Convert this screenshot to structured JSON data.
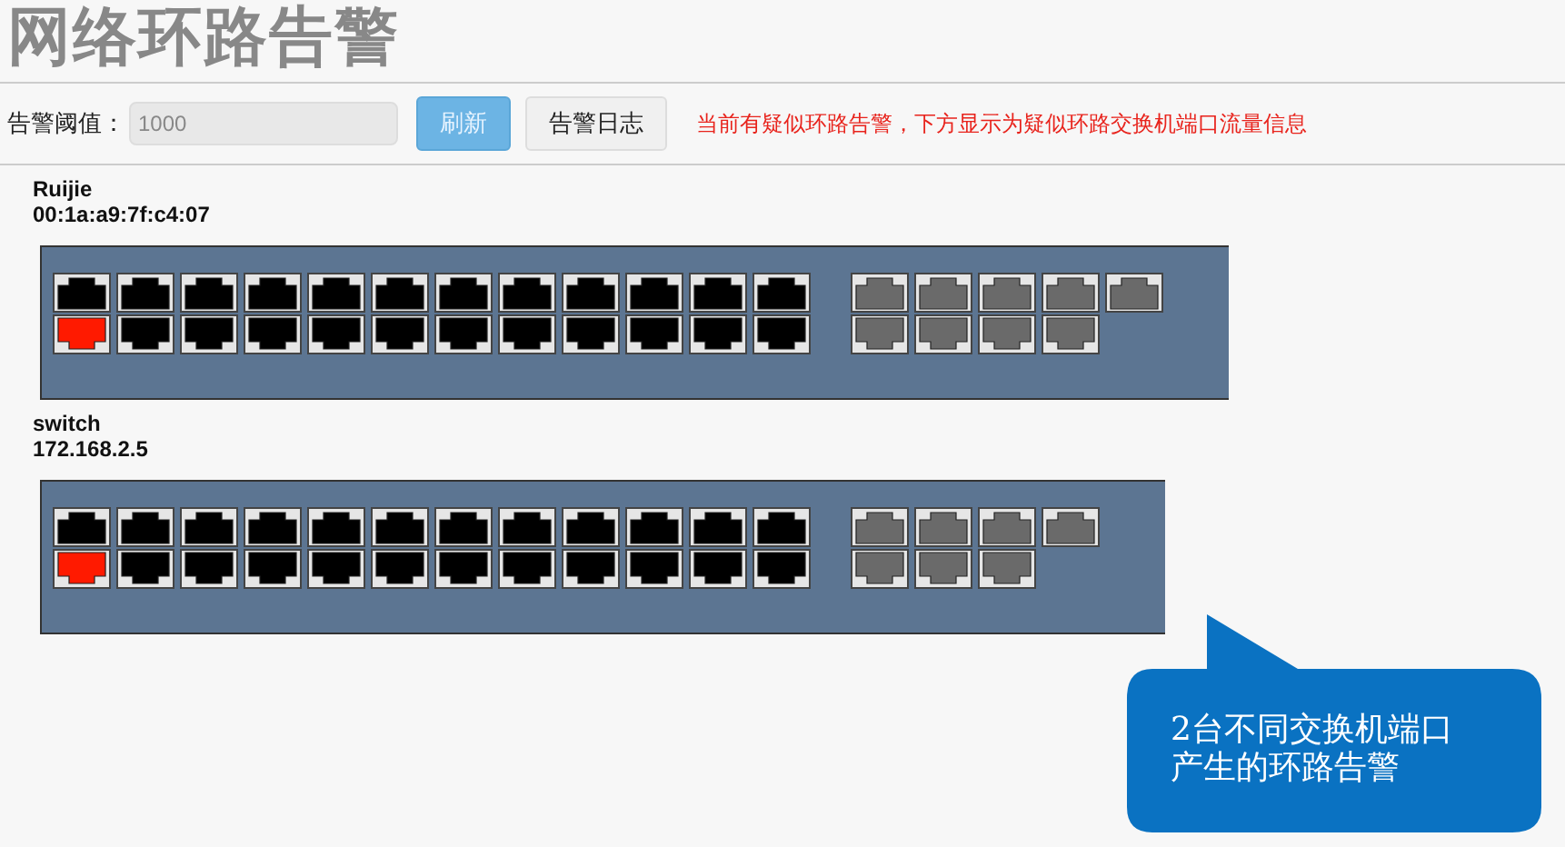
{
  "title": "网络环路告警",
  "toolbar": {
    "threshold_label": "告警阈值：",
    "threshold_value": "1000",
    "buttons": [
      {
        "label": "刷新",
        "kind": "primary"
      },
      {
        "label": "告警日志",
        "kind": "default"
      }
    ],
    "notice": "当前有疑似环路告警，下方显示为疑似环路交换机端口流量信息"
  },
  "switches": [
    {
      "name": "Ruijie",
      "address": "00:1a:a9:7f:c4:07",
      "port_columns": [
        {
          "kind": "copper",
          "ports": [
            {
              "alarm": false
            },
            {
              "alarm": true
            }
          ]
        },
        {
          "kind": "copper",
          "ports": [
            {
              "alarm": false
            },
            {
              "alarm": false
            }
          ]
        },
        {
          "kind": "copper",
          "ports": [
            {
              "alarm": false
            },
            {
              "alarm": false
            }
          ]
        },
        {
          "kind": "copper",
          "ports": [
            {
              "alarm": false
            },
            {
              "alarm": false
            }
          ]
        },
        {
          "kind": "copper",
          "ports": [
            {
              "alarm": false
            },
            {
              "alarm": false
            }
          ]
        },
        {
          "kind": "copper",
          "ports": [
            {
              "alarm": false
            },
            {
              "alarm": false
            }
          ]
        },
        {
          "kind": "copper",
          "ports": [
            {
              "alarm": false
            },
            {
              "alarm": false
            }
          ]
        },
        {
          "kind": "copper",
          "ports": [
            {
              "alarm": false
            },
            {
              "alarm": false
            }
          ]
        },
        {
          "kind": "copper",
          "ports": [
            {
              "alarm": false
            },
            {
              "alarm": false
            }
          ]
        },
        {
          "kind": "copper",
          "ports": [
            {
              "alarm": false
            },
            {
              "alarm": false
            }
          ]
        },
        {
          "kind": "copper",
          "ports": [
            {
              "alarm": false
            },
            {
              "alarm": false
            }
          ]
        },
        {
          "kind": "copper",
          "ports": [
            {
              "alarm": false
            },
            {
              "alarm": false
            }
          ]
        },
        {
          "kind": "sfp",
          "ports": [
            {
              "alarm": false
            },
            {
              "alarm": false
            }
          ]
        },
        {
          "kind": "sfp",
          "ports": [
            {
              "alarm": false
            },
            {
              "alarm": false
            }
          ]
        },
        {
          "kind": "sfp",
          "ports": [
            {
              "alarm": false
            },
            {
              "alarm": false
            }
          ]
        },
        {
          "kind": "sfp",
          "ports": [
            {
              "alarm": false
            },
            {
              "alarm": false
            }
          ]
        },
        {
          "kind": "sfp",
          "ports": [
            {
              "alarm": false
            }
          ]
        }
      ]
    },
    {
      "name": "switch",
      "address": "172.168.2.5",
      "port_columns": [
        {
          "kind": "copper",
          "ports": [
            {
              "alarm": false
            },
            {
              "alarm": true
            }
          ]
        },
        {
          "kind": "copper",
          "ports": [
            {
              "alarm": false
            },
            {
              "alarm": false
            }
          ]
        },
        {
          "kind": "copper",
          "ports": [
            {
              "alarm": false
            },
            {
              "alarm": false
            }
          ]
        },
        {
          "kind": "copper",
          "ports": [
            {
              "alarm": false
            },
            {
              "alarm": false
            }
          ]
        },
        {
          "kind": "copper",
          "ports": [
            {
              "alarm": false
            },
            {
              "alarm": false
            }
          ]
        },
        {
          "kind": "copper",
          "ports": [
            {
              "alarm": false
            },
            {
              "alarm": false
            }
          ]
        },
        {
          "kind": "copper",
          "ports": [
            {
              "alarm": false
            },
            {
              "alarm": false
            }
          ]
        },
        {
          "kind": "copper",
          "ports": [
            {
              "alarm": false
            },
            {
              "alarm": false
            }
          ]
        },
        {
          "kind": "copper",
          "ports": [
            {
              "alarm": false
            },
            {
              "alarm": false
            }
          ]
        },
        {
          "kind": "copper",
          "ports": [
            {
              "alarm": false
            },
            {
              "alarm": false
            }
          ]
        },
        {
          "kind": "copper",
          "ports": [
            {
              "alarm": false
            },
            {
              "alarm": false
            }
          ]
        },
        {
          "kind": "copper",
          "ports": [
            {
              "alarm": false
            },
            {
              "alarm": false
            }
          ]
        },
        {
          "kind": "sfp",
          "ports": [
            {
              "alarm": false
            },
            {
              "alarm": false
            }
          ]
        },
        {
          "kind": "sfp",
          "ports": [
            {
              "alarm": false
            },
            {
              "alarm": false
            }
          ]
        },
        {
          "kind": "sfp",
          "ports": [
            {
              "alarm": false
            },
            {
              "alarm": false
            }
          ]
        },
        {
          "kind": "sfp",
          "ports": [
            {
              "alarm": false
            }
          ]
        }
      ]
    }
  ],
  "callout": {
    "lines": [
      "2台不同交换机端口",
      "产生的环路告警"
    ]
  }
}
